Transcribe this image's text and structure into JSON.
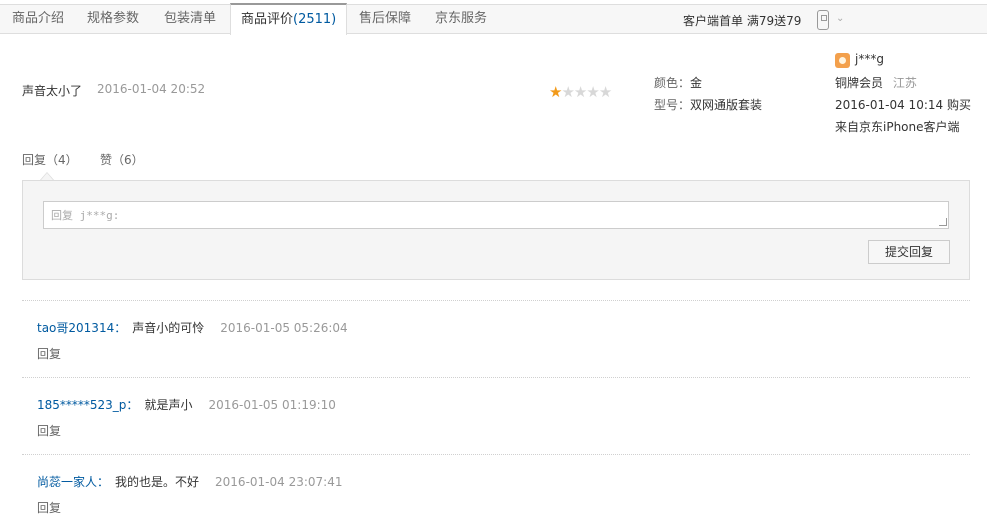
{
  "tabs": [
    {
      "label": "商品介绍"
    },
    {
      "label": "规格参数"
    },
    {
      "label": "包装清单"
    },
    {
      "label": "商品评价",
      "count": "(2511)"
    },
    {
      "label": "售后保障"
    },
    {
      "label": "京东服务"
    }
  ],
  "promo": "客户端首单 满79送79",
  "review": {
    "text": "声音太小了",
    "date": "2016-01-04 20:52",
    "rating": 1,
    "attributes": [
      {
        "key": "颜色：",
        "value": "金"
      },
      {
        "key": "型号：",
        "value": "双网通版套装"
      }
    ],
    "user": {
      "name": "j***g",
      "level": "铜牌会员",
      "location": "江苏",
      "purchase": "2016-01-04 10:14 购买",
      "source": "来自京东iPhone客户端"
    },
    "reply_action": "回复（4）",
    "like_action": "赞（6）"
  },
  "reply_form": {
    "placeholder": "回复 j***g:",
    "submit_label": "提交回复"
  },
  "replies": [
    {
      "name": "tao哥201314：",
      "content": "声音小的可怜",
      "date": "2016-01-05 05:26:04",
      "action": "回复"
    },
    {
      "name": "185*****523_p：",
      "content": "就是声小",
      "date": "2016-01-05 01:19:10",
      "action": "回复"
    },
    {
      "name": "尚蕊一家人：",
      "content": "我的也是。不好",
      "date": "2016-01-04 23:07:41",
      "action": "回复"
    }
  ],
  "colors": {
    "link": "#005aa0",
    "star": "#f29a1a",
    "muted": "#999999"
  },
  "icons": [
    "phone-icon",
    "chevron-down-icon",
    "star-icon",
    "user-avatar-icon"
  ]
}
